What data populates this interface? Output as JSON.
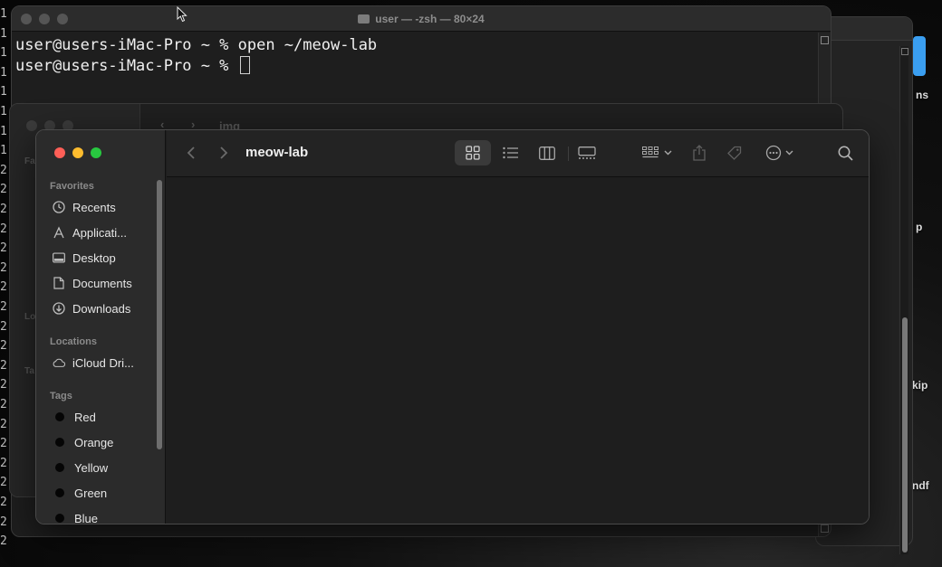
{
  "desktop": {
    "right_labels": [
      "ns",
      "p",
      "kip",
      "ndf"
    ],
    "left_strip_chars": [
      "1",
      "1",
      "1",
      "1",
      "1",
      "1",
      "1",
      "1",
      "2",
      "2",
      "2",
      "2",
      "2",
      "2",
      "2",
      "2",
      "2",
      "2",
      "2",
      "2",
      "2",
      "2",
      "2",
      "2",
      "2",
      "2",
      "2",
      "2"
    ]
  },
  "terminal": {
    "title": "user — -zsh — 80×24",
    "lines": [
      "user@users-iMac-Pro ~ % open ~/meow-lab",
      "user@users-iMac-Pro ~ % "
    ]
  },
  "ghost_finder": {
    "path_title": "img",
    "sidebar_sections": [
      "Fa",
      "Lo",
      "Ta"
    ]
  },
  "finder": {
    "title": "meow-lab",
    "sidebar": {
      "favorites_header": "Favorites",
      "favorites": [
        {
          "label": "Recents",
          "icon": "clock-icon"
        },
        {
          "label": "Applicati...",
          "icon": "applications-icon"
        },
        {
          "label": "Desktop",
          "icon": "desktop-icon"
        },
        {
          "label": "Documents",
          "icon": "document-icon"
        },
        {
          "label": "Downloads",
          "icon": "download-icon"
        }
      ],
      "locations_header": "Locations",
      "locations": [
        {
          "label": "iCloud Dri...",
          "icon": "cloud-icon"
        }
      ],
      "tags_header": "Tags",
      "tags": [
        {
          "label": "Red"
        },
        {
          "label": "Orange"
        },
        {
          "label": "Yellow"
        },
        {
          "label": "Green"
        },
        {
          "label": "Blue"
        }
      ]
    },
    "active_view": "icon",
    "colors": {
      "close": "#ff5f57",
      "minimize": "#febc2e",
      "zoom": "#28c840"
    }
  }
}
